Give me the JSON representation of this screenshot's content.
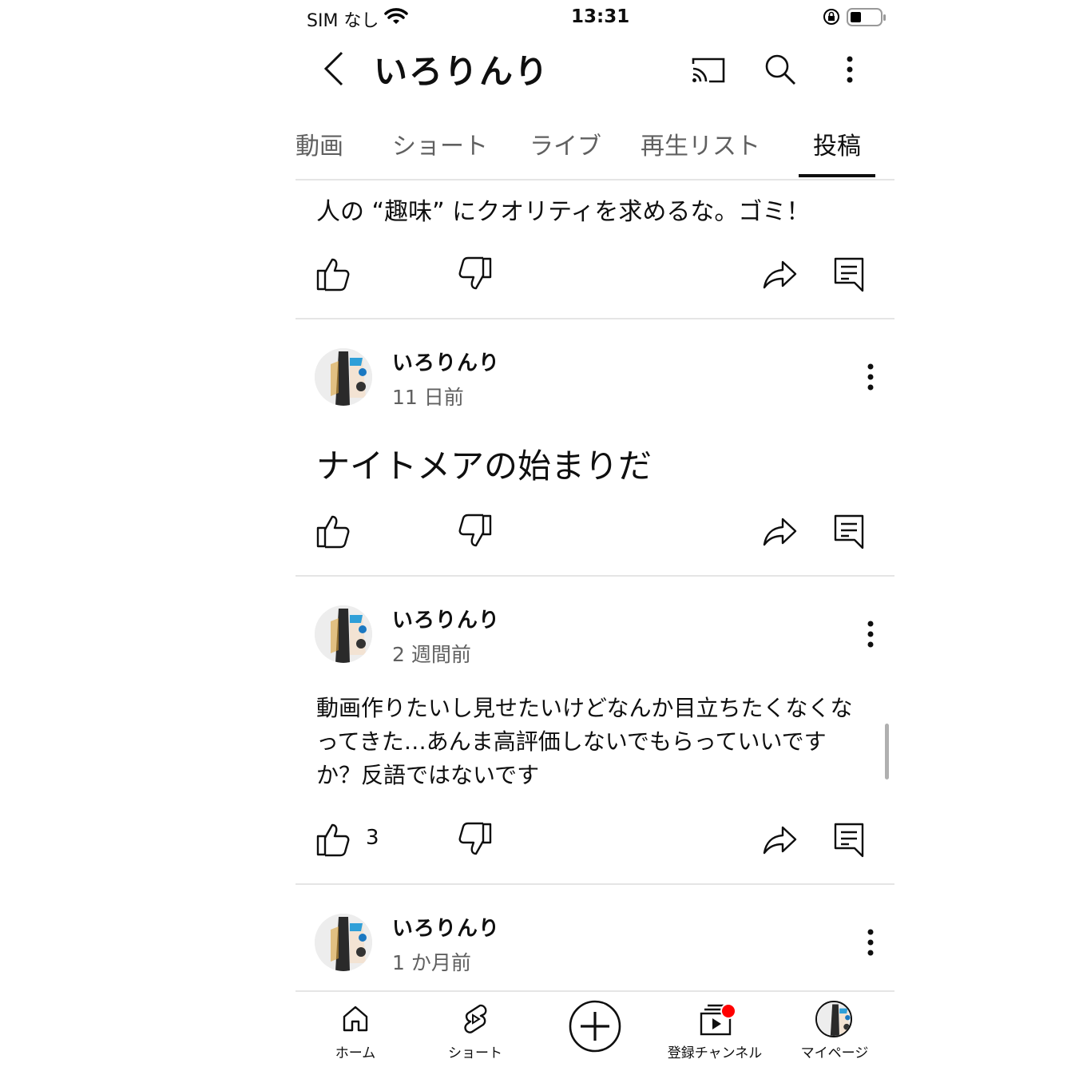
{
  "status_bar": {
    "carrier": "SIM なし",
    "time": "13:31"
  },
  "header": {
    "channel_name": "いろりんり"
  },
  "tabs": [
    {
      "label": "動画"
    },
    {
      "label": "ショート"
    },
    {
      "label": "ライブ"
    },
    {
      "label": "再生リスト"
    },
    {
      "label": "投稿"
    }
  ],
  "posts": [
    {
      "text": "人の “趣味” にクオリティを求めるな。ゴミ！"
    },
    {
      "author": "いろりんり",
      "time": "11 日前",
      "text": "ナイトメアの始まりだ"
    },
    {
      "author": "いろりんり",
      "time": "2 週間前",
      "text": "動画作りたいし見せたいけどなんか目立ちたくなくなってきた…あんま高評価しないでもらっていいですか？反語ではないです",
      "likes": "3"
    },
    {
      "author": "いろりんり",
      "time": "1 か月前"
    }
  ],
  "bottom_nav": [
    {
      "label": "ホーム"
    },
    {
      "label": "ショート"
    },
    {
      "label": "登録チャンネル"
    },
    {
      "label": "マイページ"
    }
  ],
  "colors": {
    "notification_dot": "#ff0000",
    "active_tab_underline": "#0f0f0f",
    "secondary_text": "#606060"
  }
}
